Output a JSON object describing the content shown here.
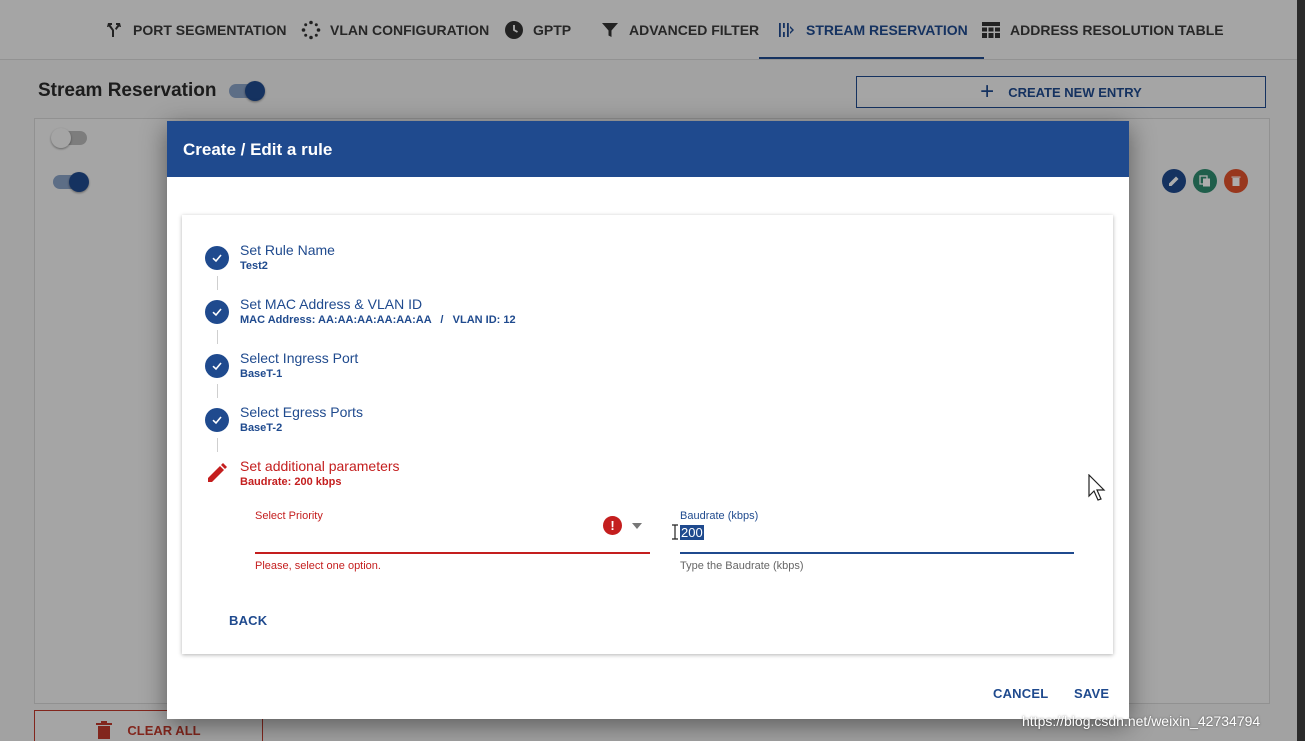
{
  "tabs": [
    {
      "label": "PORT SEGMENTATION",
      "icon": "fork-icon"
    },
    {
      "label": "VLAN CONFIGURATION",
      "icon": "dots-icon"
    },
    {
      "label": "GPTP",
      "icon": "clock-icon"
    },
    {
      "label": "ADVANCED FILTER",
      "icon": "filter-icon"
    },
    {
      "label": "STREAM RESERVATION",
      "icon": "stream-icon",
      "active": true
    },
    {
      "label": "ADDRESS RESOLUTION TABLE",
      "icon": "table-icon"
    }
  ],
  "page": {
    "title": "Stream Reservation",
    "toggle_on": true,
    "create_label": "CREATE NEW ENTRY",
    "clear_label": "CLEAR ALL"
  },
  "rows": [
    {
      "enabled": false
    },
    {
      "enabled": true
    }
  ],
  "dialog": {
    "title": "Create / Edit a rule",
    "steps": [
      {
        "title": "Set Rule Name",
        "summary": "Test2",
        "status": "done"
      },
      {
        "title": "Set MAC Address & VLAN ID",
        "summary": "MAC Address: AA:AA:AA:AA:AA:AA   /   VLAN ID: 12",
        "status": "done"
      },
      {
        "title": "Select Ingress Port",
        "summary": "BaseT-1",
        "status": "done"
      },
      {
        "title": "Select Egress Ports",
        "summary": "BaseT-2",
        "status": "done"
      },
      {
        "title": "Set additional parameters",
        "summary": "Baudrate: 200 kbps",
        "status": "editing-error"
      }
    ],
    "priority": {
      "label": "Select Priority",
      "value": "",
      "error": "Please, select one option."
    },
    "baudrate": {
      "label": "Baudrate (kbps)",
      "value": "200",
      "hint": "Type the Baudrate (kbps)"
    },
    "back_label": "BACK",
    "cancel_label": "CANCEL",
    "save_label": "SAVE"
  },
  "watermark": "https://blog.csdn.net/weixin_42734794",
  "colors": {
    "primary": "#1f4a8e",
    "error": "#c41e1e",
    "teal": "#2e8b6f",
    "danger": "#e0512c"
  }
}
